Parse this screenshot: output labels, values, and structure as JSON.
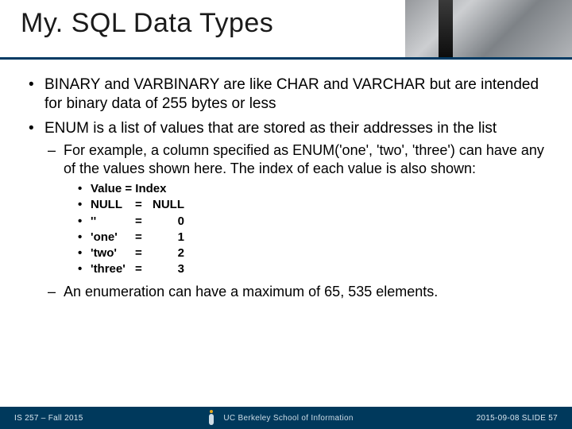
{
  "title": "My. SQL Data Types",
  "bullets": {
    "b1": "BINARY and VARBINARY are like CHAR and VARCHAR but are intended for binary data of 255 bytes or less",
    "b2": "ENUM is a list of values that are stored as their addresses in the list",
    "b2_sub1": "For example, a column specified as ENUM('one', 'two', 'three') can have any of the values shown here. The index of each value is also shown:",
    "b2_table_header": "Value = Index",
    "b2_rows": [
      {
        "value": "NULL",
        "eq": "=",
        "index": "NULL"
      },
      {
        "value": "''",
        "eq": "=",
        "index": "0"
      },
      {
        "value": "'one'",
        "eq": "=",
        "index": "1"
      },
      {
        "value": "'two'",
        "eq": "=",
        "index": "2"
      },
      {
        "value": "'three'",
        "eq": "=",
        "index": "3"
      }
    ],
    "b2_sub2": "An enumeration can have a maximum of 65, 535 elements."
  },
  "footer": {
    "left": "IS 257 – Fall 2015",
    "mid": "UC Berkeley School of Information",
    "right": "2015-09-08  SLIDE 57"
  }
}
